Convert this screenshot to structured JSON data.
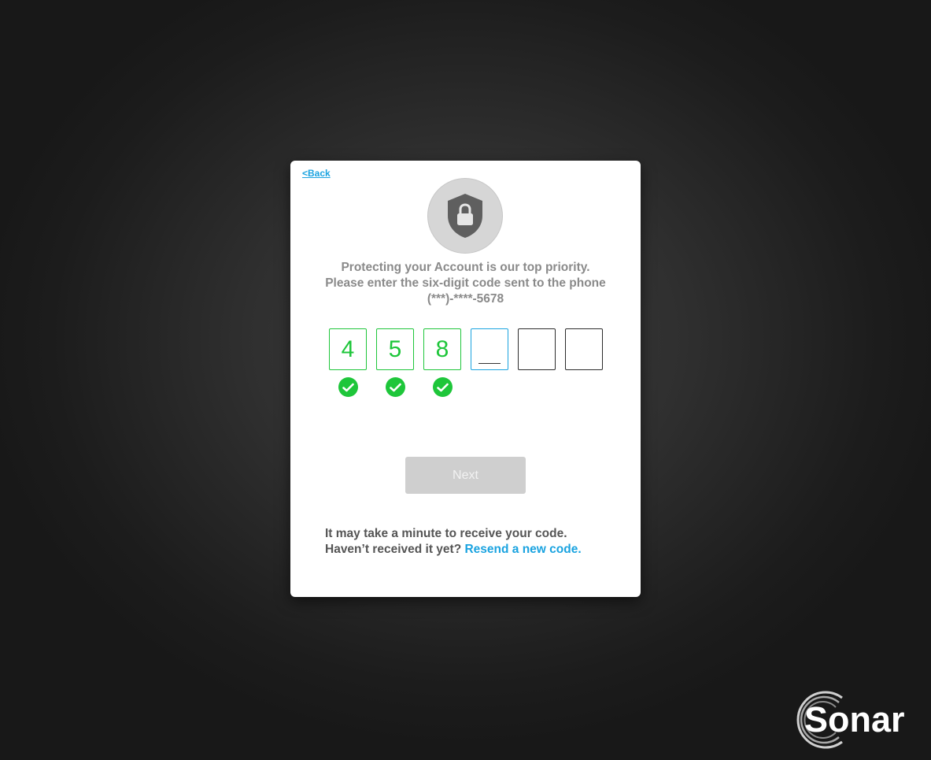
{
  "back_link": "<Back",
  "message": "Protecting your Account is our top priority. Please enter the six-digit code sent to the phone (***)-****-5678",
  "code": {
    "digits": [
      "4",
      "5",
      "8",
      "",
      "",
      ""
    ],
    "verified": [
      true,
      true,
      true,
      false,
      false,
      false
    ],
    "active_index": 3
  },
  "next_button": "Next",
  "footer": {
    "line1": "It may take a minute to receive your code.",
    "line2_prefix": "Haven’t received it yet?",
    "resend_link": "Resend a new code."
  },
  "logo": "Sonar",
  "colors": {
    "accent_blue": "#1aa3e0",
    "success_green": "#1ec63a",
    "button_disabled": "#cfcfcf"
  },
  "icons": {
    "header": "shield-lock-icon",
    "verified": "check-circle-icon"
  }
}
